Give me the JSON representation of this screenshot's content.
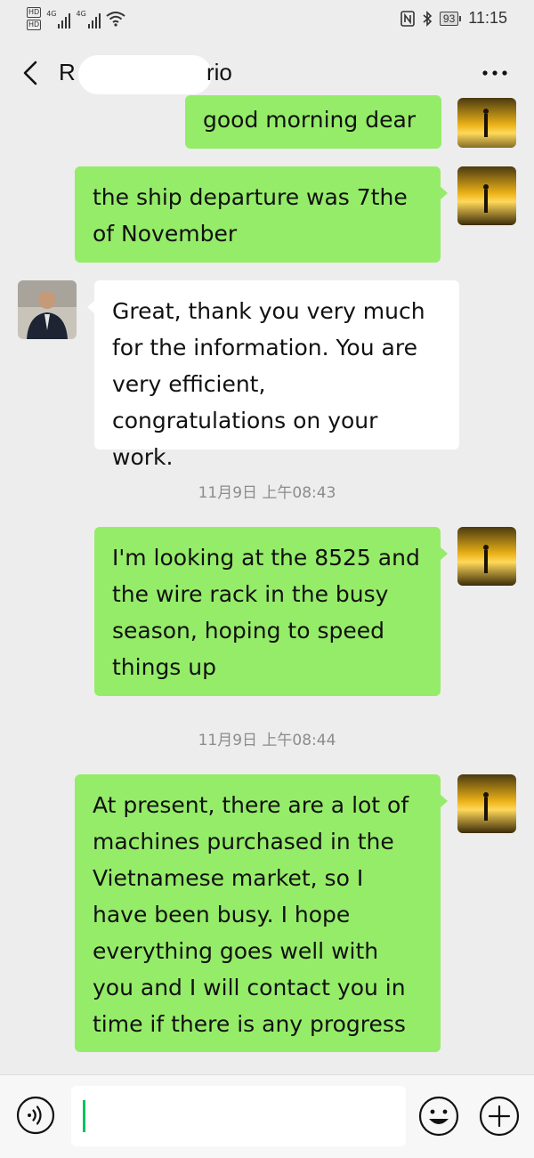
{
  "status_bar": {
    "hd_badges": [
      "HD",
      "HD"
    ],
    "net_labels": [
      "4G",
      "4G"
    ],
    "battery_level": "93",
    "time": "11:15"
  },
  "header": {
    "title_start": "R",
    "title_end": "rio",
    "more_label": "•••"
  },
  "messages": [
    {
      "side": "right",
      "text": "good morning dear"
    },
    {
      "side": "right",
      "text": "the ship departure was 7the of November"
    },
    {
      "side": "left",
      "text": "Great, thank you very much for the information. You are very efficient, congratulations on your work."
    },
    {
      "timestamp": "11月9日 上午08:43"
    },
    {
      "side": "right",
      "text": "I'm looking at the 8525 and the wire rack in the busy season, hoping to speed things up"
    },
    {
      "timestamp": "11月9日 上午08:44"
    },
    {
      "side": "right",
      "text": "At present, there are a lot of machines purchased in the Vietnamese market, so I have been busy. I hope everything goes well with you and I will contact you in time if there is any progress"
    }
  ],
  "input": {
    "value": "",
    "placeholder": ""
  },
  "colors": {
    "self_bubble": "#95ec69",
    "other_bubble": "#ffffff",
    "background": "#ededed",
    "cursor": "#07c160"
  }
}
